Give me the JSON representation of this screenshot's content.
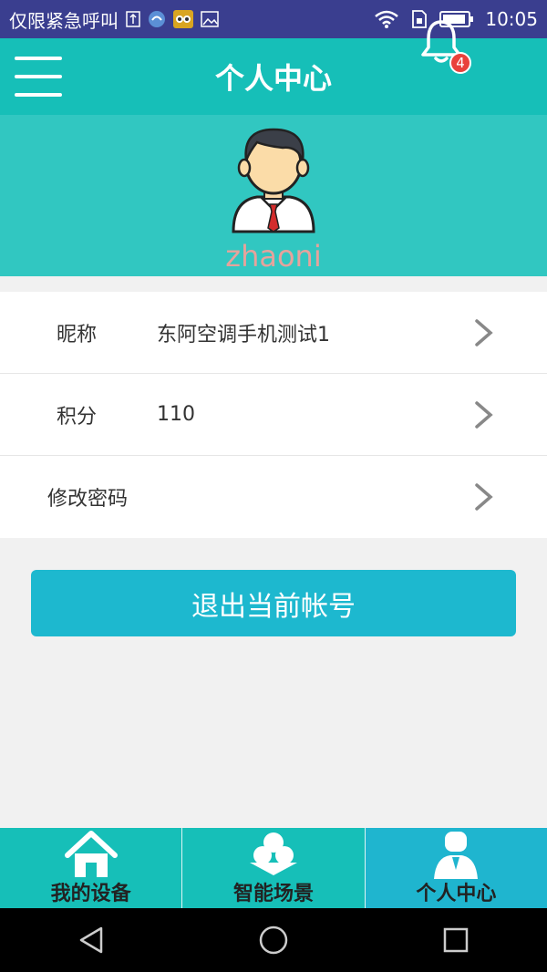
{
  "status_bar": {
    "carrier_text": "仅限紧急呼叫",
    "time": "10:05"
  },
  "header": {
    "title": "个人中心",
    "notification_count": "4"
  },
  "profile": {
    "username": "zhaoni"
  },
  "list": {
    "nickname": {
      "label": "昵称",
      "value": "东阿空调手机测试1"
    },
    "points": {
      "label": "积分",
      "value": "110"
    },
    "change_password": {
      "label": "修改密码"
    }
  },
  "logout_label": "退出当前帐号",
  "tabs": [
    {
      "label": "我的设备",
      "icon": "home-icon"
    },
    {
      "label": "智能场景",
      "icon": "scene-icon"
    },
    {
      "label": "个人中心",
      "icon": "person-icon",
      "active": true
    }
  ],
  "colors": {
    "primary": "#16bfb8",
    "active_tab": "#1fb5cf",
    "logout_button": "#1db8cf",
    "badge": "#e9413b"
  }
}
